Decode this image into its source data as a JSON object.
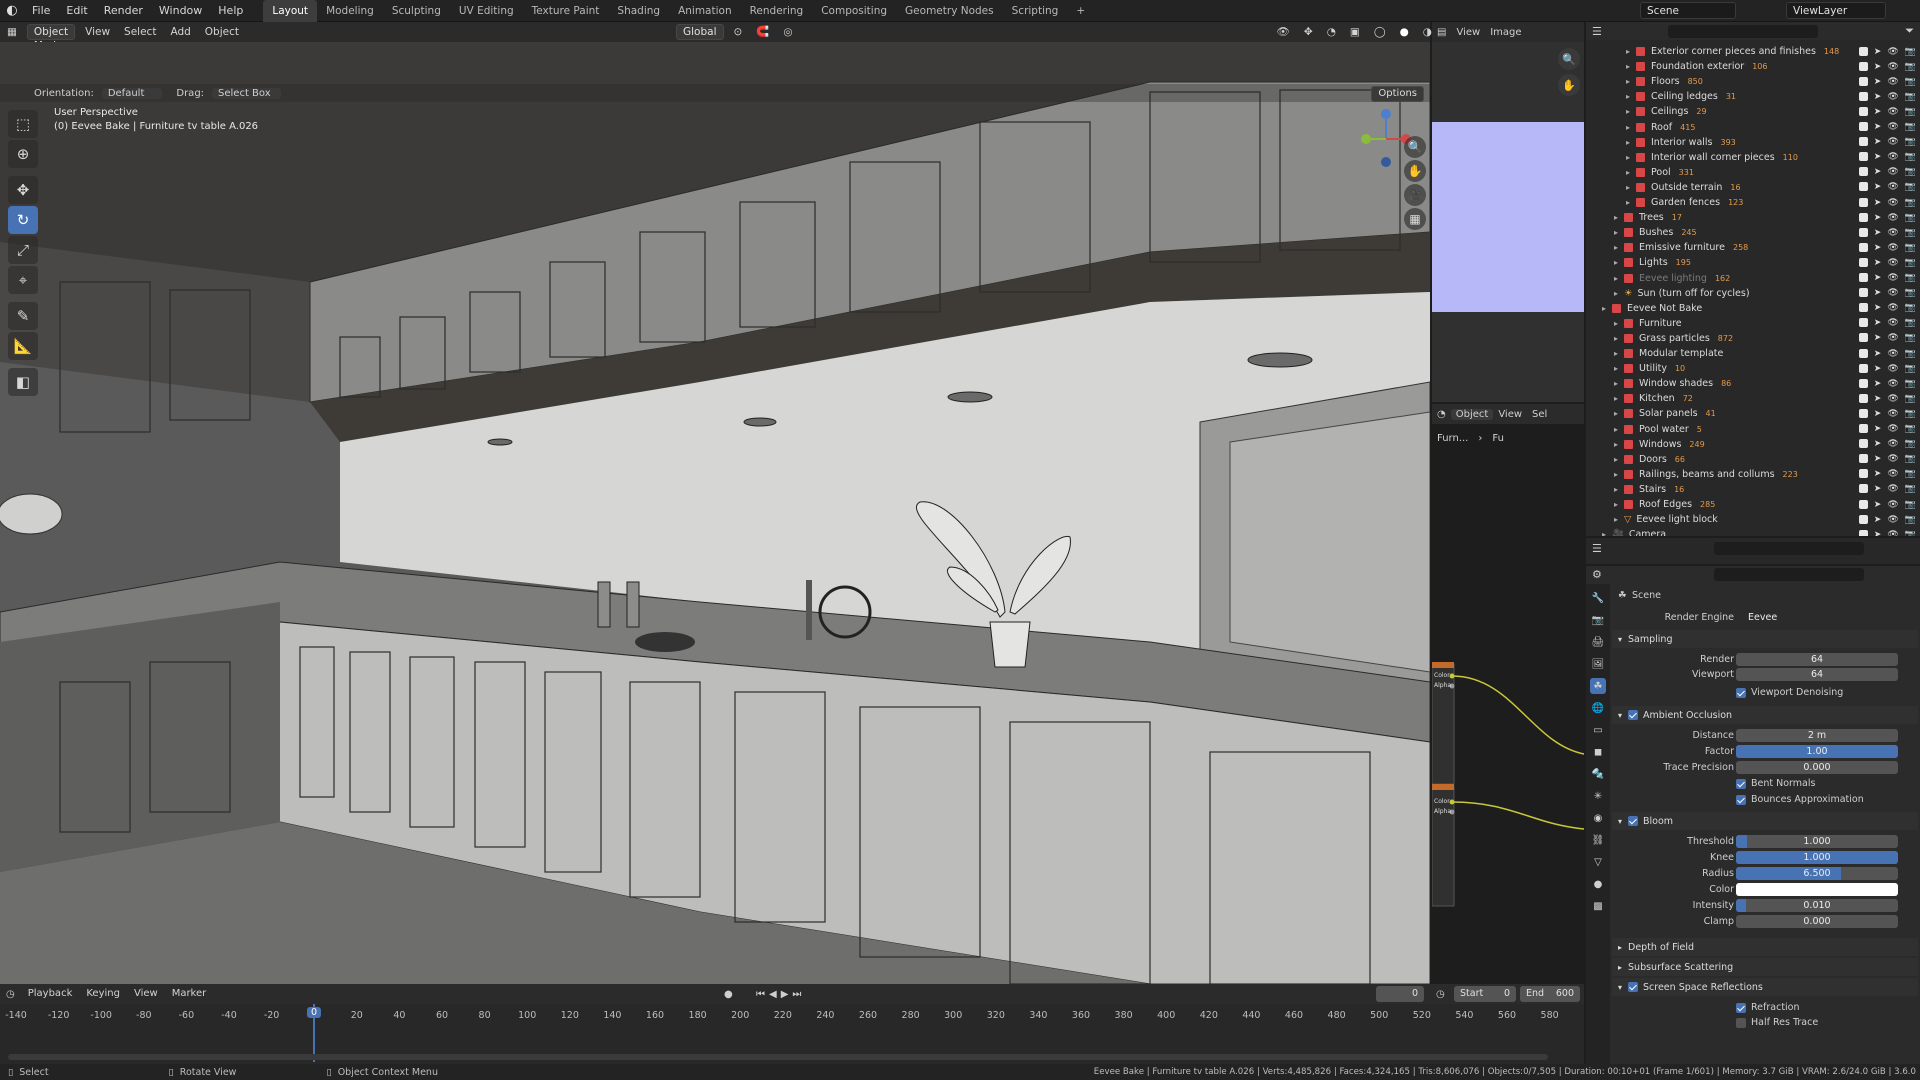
{
  "topbar": {
    "menus": [
      "File",
      "Edit",
      "Render",
      "Window",
      "Help"
    ],
    "workspaces": [
      "Layout",
      "Modeling",
      "Sculpting",
      "UV Editing",
      "Texture Paint",
      "Shading",
      "Animation",
      "Rendering",
      "Compositing",
      "Geometry Nodes",
      "Scripting"
    ],
    "active_workspace": "Layout",
    "scene": "Scene",
    "view_layer": "ViewLayer"
  },
  "viewport_header": {
    "mode": "Object Mode",
    "menus": [
      "View",
      "Select",
      "Add",
      "Object"
    ],
    "transform": "Global",
    "orientation_label": "Orientation:",
    "orientation": "Default",
    "drag_label": "Drag:",
    "drag": "Select Box",
    "options": "Options"
  },
  "viewport": {
    "perspective": "User Perspective",
    "active_object": "(0) Eevee Bake | Furniture tv table A.026"
  },
  "image_editor": {
    "menus": [
      "View",
      "Image"
    ]
  },
  "node_editor": {
    "object_dropdown": "Object",
    "menus": [
      "View",
      "Sel"
    ],
    "breadcrumb": [
      "Furn...",
      "Fu"
    ],
    "node_labels": [
      "Color",
      "Alpha"
    ]
  },
  "outliner": {
    "rows": [
      {
        "label": "Exterior corner pieces and finishes",
        "count": "148",
        "depth": 2,
        "type": "coll"
      },
      {
        "label": "Foundation exterior",
        "count": "106",
        "depth": 2,
        "type": "coll"
      },
      {
        "label": "Floors",
        "count": "850",
        "depth": 2,
        "type": "coll"
      },
      {
        "label": "Ceiling ledges",
        "count": "31",
        "depth": 2,
        "type": "coll"
      },
      {
        "label": "Ceilings",
        "count": "29",
        "depth": 2,
        "type": "coll"
      },
      {
        "label": "Roof",
        "count": "415",
        "depth": 2,
        "type": "coll"
      },
      {
        "label": "Interior walls",
        "count": "393",
        "depth": 2,
        "type": "coll"
      },
      {
        "label": "Interior wall corner pieces",
        "count": "110",
        "depth": 2,
        "type": "coll"
      },
      {
        "label": "Pool",
        "count": "331",
        "depth": 2,
        "type": "coll"
      },
      {
        "label": "Outside terrain",
        "count": "16",
        "depth": 2,
        "type": "coll"
      },
      {
        "label": "Garden fences",
        "count": "123",
        "depth": 2,
        "type": "coll"
      },
      {
        "label": "Trees",
        "count": "17",
        "depth": 1,
        "type": "coll"
      },
      {
        "label": "Bushes",
        "count": "245",
        "depth": 1,
        "type": "coll"
      },
      {
        "label": "Emissive furniture",
        "count": "258",
        "depth": 1,
        "type": "coll"
      },
      {
        "label": "Lights",
        "count": "195",
        "depth": 1,
        "type": "coll"
      },
      {
        "label": "Eevee lighting",
        "count": "162",
        "depth": 1,
        "type": "dim"
      },
      {
        "label": "Sun (turn off for cycles)",
        "count": "",
        "depth": 1,
        "type": "sun"
      },
      {
        "label": "Eevee Not Bake",
        "count": "",
        "depth": 0,
        "type": "coll"
      },
      {
        "label": "Furniture",
        "count": "",
        "depth": 1,
        "type": "coll"
      },
      {
        "label": "Grass particles",
        "count": "872",
        "depth": 1,
        "type": "coll"
      },
      {
        "label": "Modular template",
        "count": "",
        "depth": 1,
        "type": "coll"
      },
      {
        "label": "Utility",
        "count": "10",
        "depth": 1,
        "type": "coll"
      },
      {
        "label": "Window shades",
        "count": "86",
        "depth": 1,
        "type": "coll"
      },
      {
        "label": "Kitchen",
        "count": "72",
        "depth": 1,
        "type": "coll"
      },
      {
        "label": "Solar panels",
        "count": "41",
        "depth": 1,
        "type": "coll"
      },
      {
        "label": "Pool water",
        "count": "5",
        "depth": 1,
        "type": "coll"
      },
      {
        "label": "Windows",
        "count": "249",
        "depth": 1,
        "type": "coll"
      },
      {
        "label": "Doors",
        "count": "66",
        "depth": 1,
        "type": "coll"
      },
      {
        "label": "Railings, beams and collums",
        "count": "223",
        "depth": 1,
        "type": "coll"
      },
      {
        "label": "Stairs",
        "count": "16",
        "depth": 1,
        "type": "coll"
      },
      {
        "label": "Roof Edges",
        "count": "285",
        "depth": 1,
        "type": "coll"
      },
      {
        "label": "Eevee light block",
        "count": "",
        "depth": 1,
        "type": "obj"
      },
      {
        "label": "Camera",
        "count": "",
        "depth": 0,
        "type": "cam"
      }
    ]
  },
  "properties": {
    "context": "Scene",
    "render_engine_label": "Render Engine",
    "render_engine": "Eevee",
    "sampling": {
      "title": "Sampling",
      "render_label": "Render",
      "render": "64",
      "viewport_label": "Viewport",
      "viewport": "64",
      "denoise": "Viewport Denoising"
    },
    "ao": {
      "title": "Ambient Occlusion",
      "distance_label": "Distance",
      "distance": "2 m",
      "factor_label": "Factor",
      "factor": "1.00",
      "trace_label": "Trace Precision",
      "trace": "0.000",
      "bent": "Bent Normals",
      "bounces": "Bounces Approximation"
    },
    "bloom": {
      "title": "Bloom",
      "threshold_label": "Threshold",
      "threshold": "1.000",
      "knee_label": "Knee",
      "knee": "1.000",
      "radius_label": "Radius",
      "radius": "6.500",
      "color_label": "Color",
      "intensity_label": "Intensity",
      "intensity": "0.010",
      "clamp_label": "Clamp",
      "clamp": "0.000"
    },
    "dof": "Depth of Field",
    "sss": "Subsurface Scattering",
    "ssr": {
      "title": "Screen Space Reflections",
      "refraction": "Refraction",
      "half_res": "Half Res Trace"
    }
  },
  "timeline": {
    "menus": [
      "Playback",
      "Keying",
      "View",
      "Marker"
    ],
    "current_frame": "0",
    "start_label": "Start",
    "start": "0",
    "end_label": "End",
    "end": "600",
    "ticks": [
      "-140",
      "-120",
      "-100",
      "-80",
      "-60",
      "-40",
      "-20",
      "0",
      "20",
      "40",
      "60",
      "80",
      "100",
      "120",
      "140",
      "160",
      "180",
      "200",
      "220",
      "240",
      "260",
      "280",
      "300",
      "320",
      "340",
      "360",
      "380",
      "400",
      "420",
      "440",
      "460",
      "480",
      "500",
      "520",
      "540",
      "560",
      "580"
    ]
  },
  "statusbar": {
    "select": "Select",
    "rotate": "Rotate View",
    "context": "Object Context Menu",
    "stats": "Eevee Bake | Furniture tv table A.026 | Verts:4,485,826 | Faces:4,324,165 | Tris:8,606,076 | Objects:0/7,505 | Duration: 00:10+01 (Frame 1/601) | Memory: 3.7 GiB | VRAM: 2.6/24.0 GiB | 3.6.0"
  },
  "colors": {
    "accent": "#4772b3",
    "collection": "#d94646",
    "count_badge": "#e39a4c",
    "image_preview": "#b7b8f7"
  }
}
